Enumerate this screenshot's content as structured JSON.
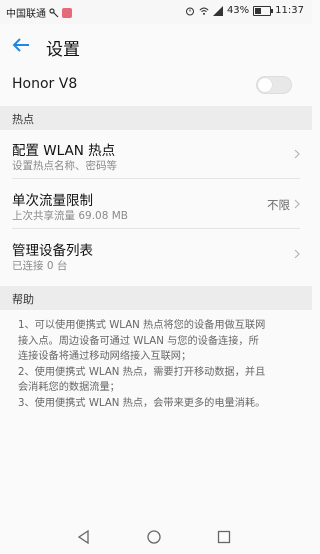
{
  "status_bar": {
    "carrier": "中国联通",
    "battery": "43%",
    "battery_level": 0.43,
    "time": "11:37"
  },
  "app_bar": {
    "title": "设置"
  },
  "hotspot_toggle": {
    "device_name": "Honor V8",
    "enabled": false
  },
  "sections": {
    "hotspot_header": "热点",
    "help_header": "帮助"
  },
  "rows": [
    {
      "title": "配置 WLAN 热点",
      "subtitle": "设置热点名称、密码等",
      "value": ""
    },
    {
      "title": "单次流量限制",
      "subtitle": "上次共享流量 69.08 MB",
      "value": "不限"
    },
    {
      "title": "管理设备列表",
      "subtitle": "已连接 0 台",
      "value": ""
    }
  ],
  "help": {
    "lines": [
      "1、可以使用便携式 WLAN 热点将您的设备用做互联网",
      "接入点。周边设备可通过 WLAN 与您的设备连接，所",
      "连接设备将通过移动网络接入互联网；",
      "2、使用便携式 WLAN 热点，需要打开移动数据，并且",
      "会消耗您的数据流量；",
      "3、使用便携式 WLAN 热点，会带来更多的电量消耗。"
    ]
  },
  "colors": {
    "accent": "#1e88e5",
    "section_bg": "#ececec",
    "toggle_off": "#e8e8e8"
  }
}
